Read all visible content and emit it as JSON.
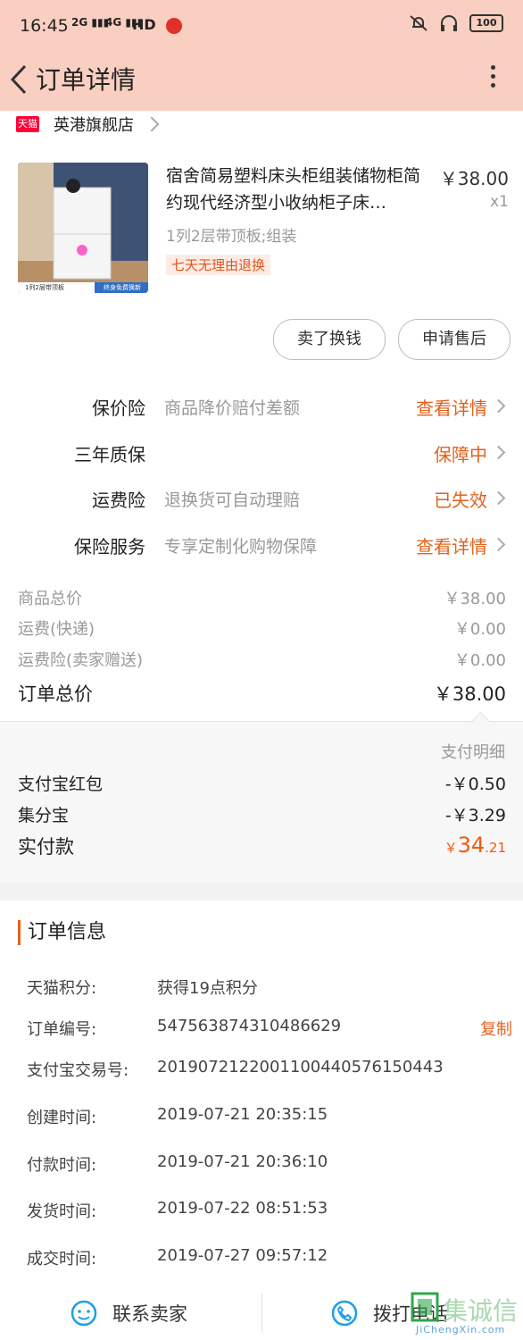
{
  "status_bar": {
    "time": "16:45",
    "sig1": "2G",
    "sig2": "4G",
    "hd": "HD",
    "battery": "100"
  },
  "header": {
    "title": "订单详情"
  },
  "shop": {
    "badge": "天猫",
    "name": "英港旗舰店"
  },
  "product": {
    "title": "宿舍简易塑料床头柜组装储物柜简约现代经济型小收纳柜子床…",
    "price": "￥38.00",
    "qty": "x1",
    "sku": "1列2层带顶板;组装",
    "tag": "七天无理由退换",
    "image_caption_left": "1列2层带顶板",
    "image_caption_right": "终身免费换新"
  },
  "actions": {
    "sell": "卖了换钱",
    "after_sale": "申请售后"
  },
  "services": [
    {
      "label": "保价险",
      "desc": "商品降价赔付差额",
      "status": "查看详情"
    },
    {
      "label": "三年质保",
      "desc": "",
      "status": "保障中"
    },
    {
      "label": "运费险",
      "desc": "退换货可自动理赔",
      "status": "已失效"
    },
    {
      "label": "保险服务",
      "desc": "专享定制化购物保障",
      "status": "查看详情"
    }
  ],
  "prices": [
    {
      "k": "商品总价",
      "v": "￥38.00"
    },
    {
      "k": "运费(快递)",
      "v": "￥0.00"
    },
    {
      "k": "运费险(卖家赠送)",
      "v": "￥0.00"
    },
    {
      "k": "订单总价",
      "v": "￥38.00"
    }
  ],
  "payment": {
    "detail_link": "支付明细",
    "lines": [
      {
        "k": "支付宝红包",
        "v": "-￥0.50"
      },
      {
        "k": "集分宝",
        "v": "-￥3.29"
      }
    ],
    "actual_label": "实付款",
    "actual_currency": "￥",
    "actual_int": "34",
    "actual_dec": ".21"
  },
  "order_info": {
    "title": "订单信息",
    "rows": [
      {
        "k": "天猫积分:",
        "v": "获得19点积分"
      },
      {
        "k": "订单编号:",
        "v": "547563874310486629",
        "action": "复制"
      },
      {
        "k": "支付宝交易号:",
        "v": "2019072122001100440576150443"
      },
      {
        "k": "创建时间:",
        "v": "2019-07-21 20:35:15"
      },
      {
        "k": "付款时间:",
        "v": "2019-07-21 20:36:10"
      },
      {
        "k": "发货时间:",
        "v": "2019-07-22 08:51:53"
      },
      {
        "k": "成交时间:",
        "v": "2019-07-27 09:57:12"
      }
    ]
  },
  "bottom": {
    "contact": "联系卖家",
    "call": "拨打电话"
  },
  "watermark": {
    "text": "集诚信",
    "url": "JiChengXin.com"
  },
  "colors": {
    "header_bg": "#f9cfc1",
    "accent": "#e2621c",
    "actual_pay": "#f25a0f",
    "tmall_red": "#ff0036",
    "icon_blue": "#1ea0e6"
  }
}
